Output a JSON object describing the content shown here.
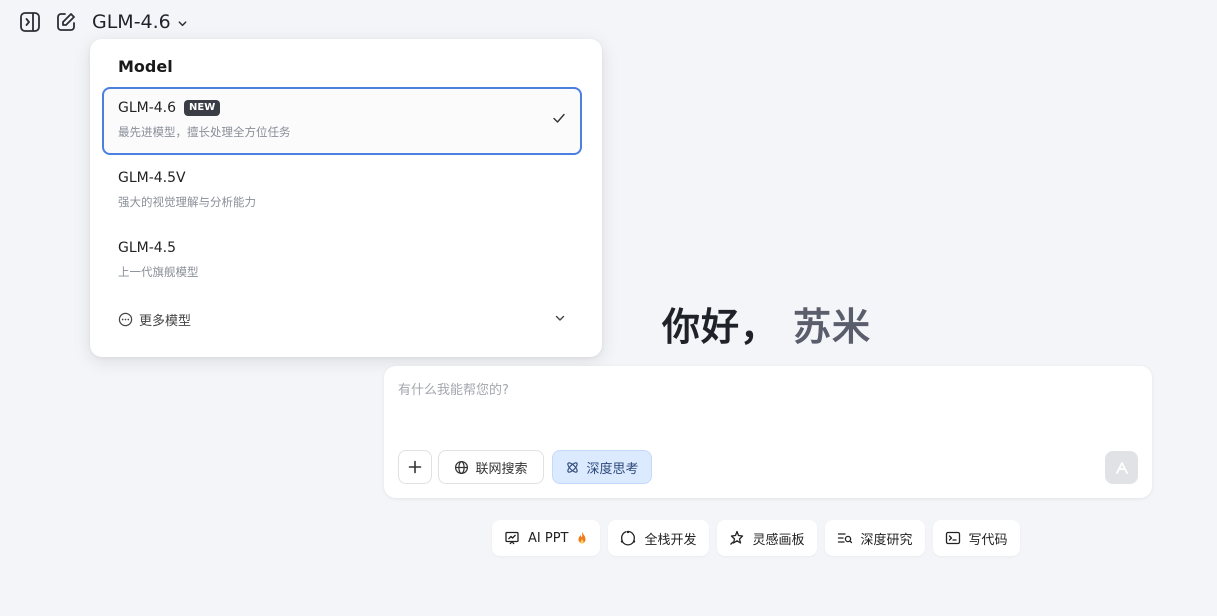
{
  "header": {
    "current_model": "GLM-4.6"
  },
  "model_menu": {
    "title": "Model",
    "options": [
      {
        "name": "GLM-4.6",
        "badge": "NEW",
        "desc": "最先进模型，擅长处理全方位任务",
        "selected": true
      },
      {
        "name": "GLM-4.5V",
        "desc": "强大的视觉理解与分析能力",
        "selected": false
      },
      {
        "name": "GLM-4.5",
        "desc": "上一代旗舰模型",
        "selected": false
      }
    ],
    "more_label": "更多模型"
  },
  "greeting": {
    "hello": "你好，",
    "name": "苏米"
  },
  "composer": {
    "placeholder": "有什么我能帮您的?",
    "web_search_label": "联网搜索",
    "deep_think_label": "深度思考"
  },
  "quick_actions": [
    {
      "label": "AI PPT",
      "icon": "presentation-icon"
    },
    {
      "label": "全栈开发",
      "icon": "fullstack-icon"
    },
    {
      "label": "灵感画板",
      "icon": "sparkle-board-icon"
    },
    {
      "label": "深度研究",
      "icon": "research-icon"
    },
    {
      "label": "写代码",
      "icon": "terminal-icon"
    }
  ],
  "colors": {
    "background": "#f4f5f8",
    "selected_border": "#4c7fe0",
    "deep_think_bg": "#dceaff",
    "fire": "#f07a1a"
  }
}
